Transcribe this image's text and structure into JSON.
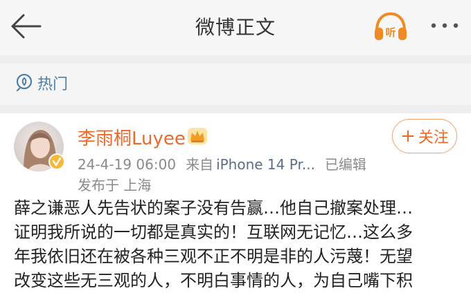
{
  "header": {
    "title": "微博正文",
    "listen_label": "听",
    "more_label": "•••",
    "accent": "#f08a24"
  },
  "hot": {
    "label": "热门"
  },
  "post": {
    "username": "李雨桐Luyee",
    "username_color": "#ea6a2a",
    "timestamp": "24-4-19 06:00",
    "source_prefix": "来自",
    "source_device": "iPhone 14 Pr...",
    "edited": "已编辑",
    "location": "发布于 上海",
    "follow_label": "关注",
    "follow_plus": "+",
    "content_lines": [
      "薛之谦恶人先告状的案子没有告赢…他自己撤案处理…",
      "证明我所说的一切都是真实的！互联网无记忆…这么多",
      "年我依旧还在被各种三观不正不明是非的人污蔑！无望",
      "改变这些无三观的人，不明白事情的人，为自己嘴下积"
    ]
  }
}
